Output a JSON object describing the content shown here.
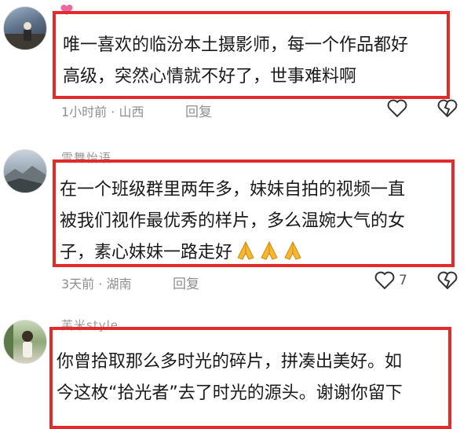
{
  "comments": [
    {
      "username": "",
      "text_lines": [
        "唯一喜欢的临汾本土摄影师，每一个作品都好",
        "高级，突然心情就不好了，世事难料啊"
      ],
      "time": "1小时前",
      "location": "山西",
      "reply_label": "回复",
      "likes": ""
    },
    {
      "username": "雪舞怡语",
      "text_lines": [
        "在一个班级群里两年多，妹妹自拍的视频一直",
        "被我们视作最优秀的样片，多么温婉大气的女",
        "子，素心妹妹一路走好"
      ],
      "time": "3天前",
      "location": "湖南",
      "reply_label": "回复",
      "likes": "7"
    },
    {
      "username": "芙米style",
      "text_lines": [
        "你曾拾取那么多时光的碎片，拼凑出美好。如",
        "今这枚“拾光者”去了时光的源头。谢谢你留下"
      ],
      "time": "",
      "location": "",
      "reply_label": "",
      "likes": ""
    }
  ],
  "meta_separator": " · ",
  "icons": {
    "like": "heart-outline-icon",
    "dislike": "broken-heart-icon",
    "pray": "folded-hands-icon"
  },
  "colors": {
    "highlight_box": "#e32b2b",
    "meta_text": "#8f8f8f"
  }
}
